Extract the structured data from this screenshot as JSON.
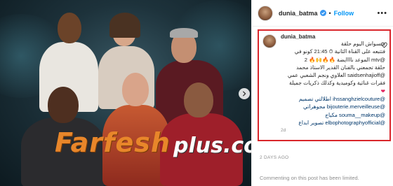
{
  "post": {
    "username": "dunia_batma",
    "follow_label": "Follow",
    "more_label": "•••"
  },
  "caption": {
    "username": "dunia_batma",
    "lines": [
      "متسواش اليوم حلقة",
      "فتتبعه على القناة الثانية ⏱ 21:45 كونو في",
      "@mtv الموعد ناااايضة 🔥🔥🙌🔥 2",
      "حلقة تجمعني بالفنان القدير الاستاذ محمد",
      "@saidsenhajioff العلاوي ونجم الشعبي عمي",
      "فقرات غنائية وكوميدية وكذلك ذكريات جميلة",
      "❤",
      "@ihssanghzielcouture اطلالتي تصميم",
      "@bijouterie.merveilleuse مجوهراتي",
      "@souma__makeup مكياج",
      "@elbophotographyofficial تصوير ابداع"
    ],
    "time": "2d"
  },
  "watermark": {
    "main": "Farfesh",
    "sub": "plus.com"
  },
  "footer": {
    "posted": "2 DAYS AGO",
    "comments_disabled": "Commenting on this post has been limited."
  },
  "icons": {
    "next": "chevron-right-icon",
    "verified": "verified-badge-icon",
    "like": "heart-outline-icon",
    "more": "more-options-icon"
  },
  "colors": {
    "highlight": "#d9262b",
    "follow": "#0095f6",
    "mention": "#00376b",
    "watermark": "#e8862a"
  }
}
